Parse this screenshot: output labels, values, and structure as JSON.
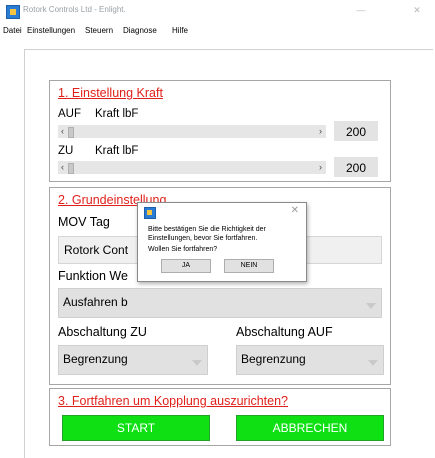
{
  "window": {
    "title": "Rotork Controls Ltd - Enlight.",
    "minimize_glyph": "—",
    "close_glyph": "✕"
  },
  "menu": [
    "Datei",
    "Einstellungen",
    "Steuern",
    "Diagnose",
    "Hilfe"
  ],
  "section1": {
    "heading": "1. Einstellung Kraft",
    "auf_label": "AUF",
    "auf_unit": "Kraft lbF",
    "auf_value": "200",
    "zu_label": "ZU",
    "zu_unit": "Kraft lbF",
    "zu_value": "200",
    "scroll_left": "‹",
    "scroll_right": "›"
  },
  "section2": {
    "heading": "2. Grundeinstellung",
    "mov_tag_label": "MOV Tag",
    "mov_tag_value": "Rotork Cont",
    "funktion_label": "Funktion We",
    "funktion_value": "Ausfahren b",
    "abschaltung_zu_label": "Abschaltung ZU",
    "abschaltung_zu_value": "Begrenzung",
    "abschaltung_auf_label": "Abschaltung AUF",
    "abschaltung_auf_value": "Begrenzung"
  },
  "section3": {
    "heading": "3. Fortfahren um Kopplung auszurichten?",
    "start_label": "START",
    "abbrechen_label": "ABBRECHEN"
  },
  "dialog": {
    "message_line1": "Bitte bestätigen Sie die Richtigkeit der",
    "message_line2": "Einstellungen, bevor Sie fortfahren.",
    "question": "Wollen Sie fortfahren?",
    "yes_label": "JA",
    "no_label": "NEIN",
    "close_glyph": "✕"
  },
  "colors": {
    "heading_red": "#e0211b",
    "button_green": "#0ee014"
  }
}
